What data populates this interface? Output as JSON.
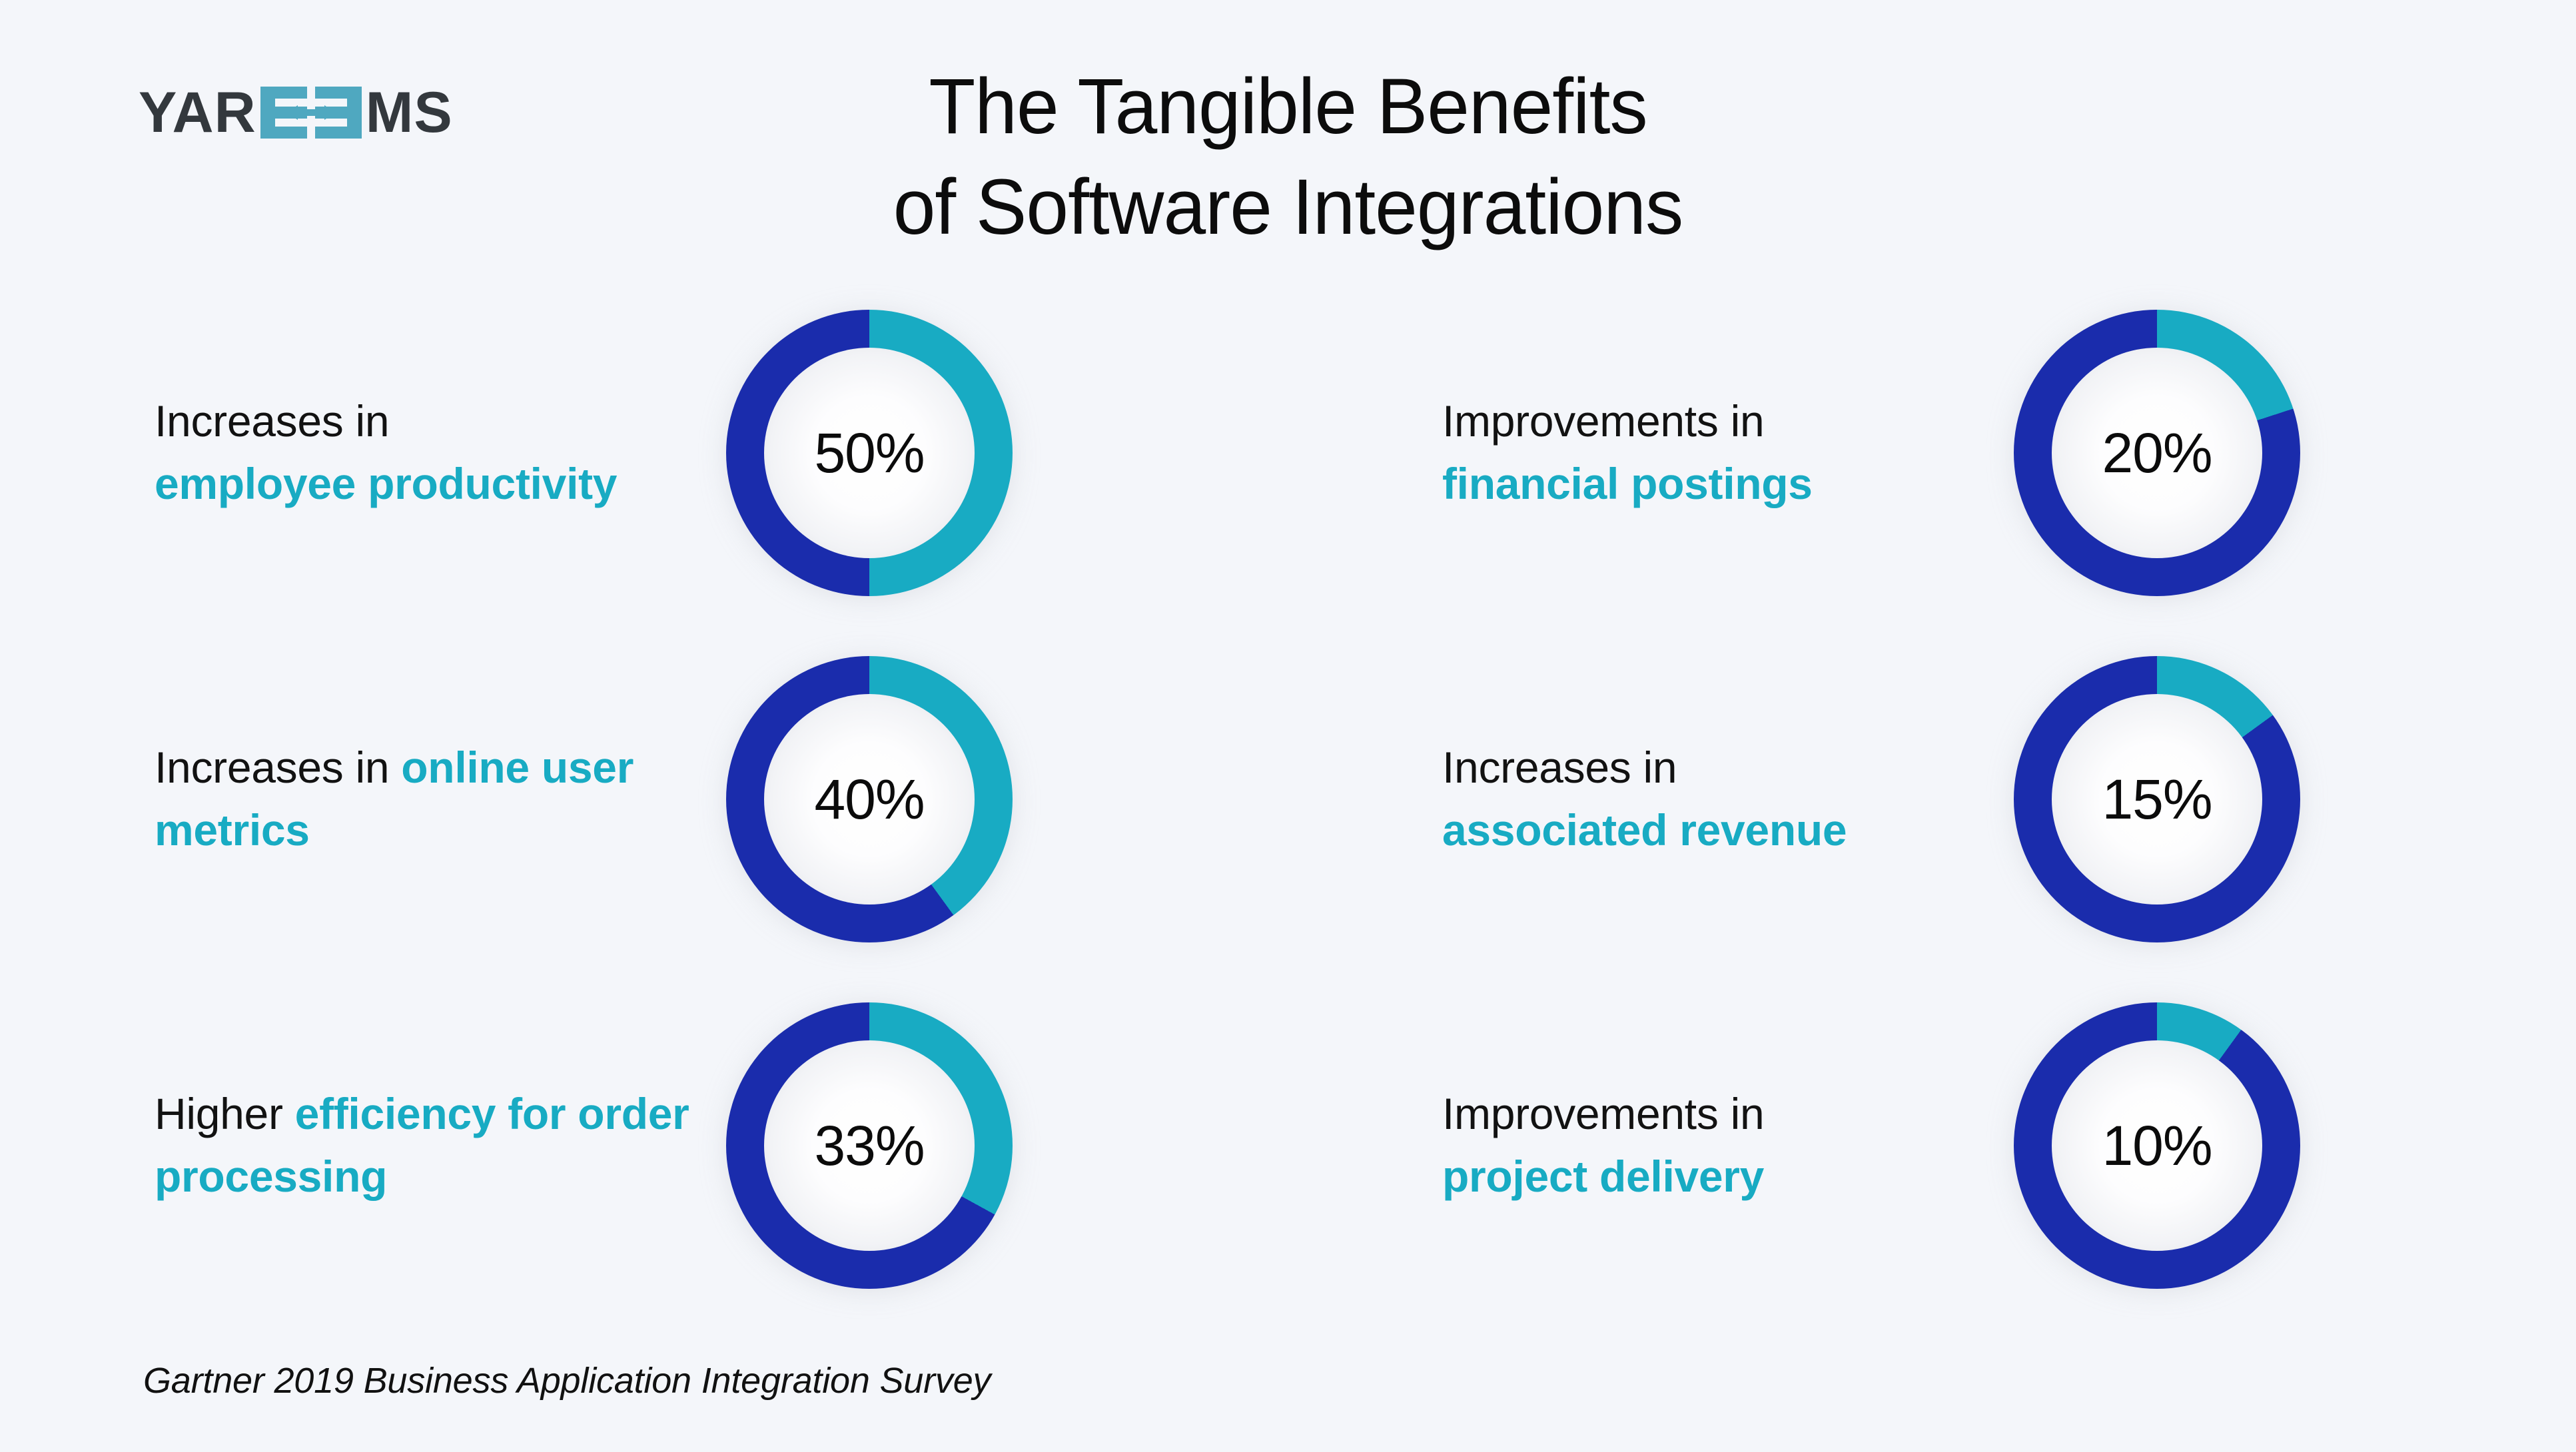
{
  "brand": {
    "name": "YAROOMS",
    "word_left": "YAR",
    "word_right": "MS",
    "logo_icon": "integration-arrows-icon",
    "text_color": "#33383d",
    "mark_color": "#4fa8c0"
  },
  "title": {
    "line1": "The Tangible Benefits",
    "line2": "of Software Integrations"
  },
  "colors": {
    "background": "#f4f6fa",
    "teal": "#18abc3",
    "blue": "#1a2cac",
    "text": "#121212"
  },
  "footer": {
    "source": "Gartner 2019 Business Application Integration Survey"
  },
  "metrics": [
    {
      "prefix": "Increases in ",
      "highlight": "employee productivity",
      "layout": "two-line-break-after-prefix",
      "value_label": "50%",
      "value": 50
    },
    {
      "prefix": "Improvements in ",
      "highlight": "financial postings",
      "layout": "two-line-break-after-prefix",
      "value_label": "20%",
      "value": 20
    },
    {
      "prefix": "Increases in ",
      "highlight": "online user metrics",
      "layout": "inline-wrap",
      "value_label": "40%",
      "value": 40
    },
    {
      "prefix": "Increases in ",
      "highlight": "associated revenue",
      "layout": "two-line-break-after-prefix",
      "value_label": "15%",
      "value": 15
    },
    {
      "prefix": "Higher ",
      "highlight": "efficiency for order processing",
      "layout": "inline-wrap",
      "value_label": "33%",
      "value": 33
    },
    {
      "prefix": "Improvements in ",
      "highlight": "project delivery",
      "layout": "two-line-break-after-prefix",
      "value_label": "10%",
      "value": 10
    }
  ],
  "chart_data": {
    "type": "pie",
    "title": "The Tangible Benefits of Software Integrations",
    "subtitle": "",
    "note": "Six donut (ring) gauges; teal arc sweeps clockwise from 12 o'clock by the stated percentage, remainder is dark blue.",
    "legend": [
      "percentage achieved (teal)",
      "remainder (blue)"
    ],
    "legend_position": "none",
    "colors": {
      "value_arc": "#18abc3",
      "remainder_arc": "#1a2cac"
    },
    "source": "Gartner 2019 Business Application Integration Survey",
    "categories": [
      "Increases in employee productivity",
      "Improvements in financial postings",
      "Increases in online user metrics",
      "Increases in associated revenue",
      "Higher efficiency for order processing",
      "Improvements in project delivery"
    ],
    "values": [
      50,
      20,
      40,
      15,
      33,
      10
    ],
    "unit": "%",
    "ylim": [
      0,
      100
    ],
    "grid": false,
    "charts": [
      {
        "label": "Increases in employee productivity",
        "value": 50,
        "display": "50%"
      },
      {
        "label": "Improvements in financial postings",
        "value": 20,
        "display": "20%"
      },
      {
        "label": "Increases in online user metrics",
        "value": 40,
        "display": "40%"
      },
      {
        "label": "Increases in associated revenue",
        "value": 15,
        "display": "15%"
      },
      {
        "label": "Higher efficiency for order processing",
        "value": 33,
        "display": "33%"
      },
      {
        "label": "Improvements in project delivery",
        "value": 10,
        "display": "10%"
      }
    ]
  }
}
